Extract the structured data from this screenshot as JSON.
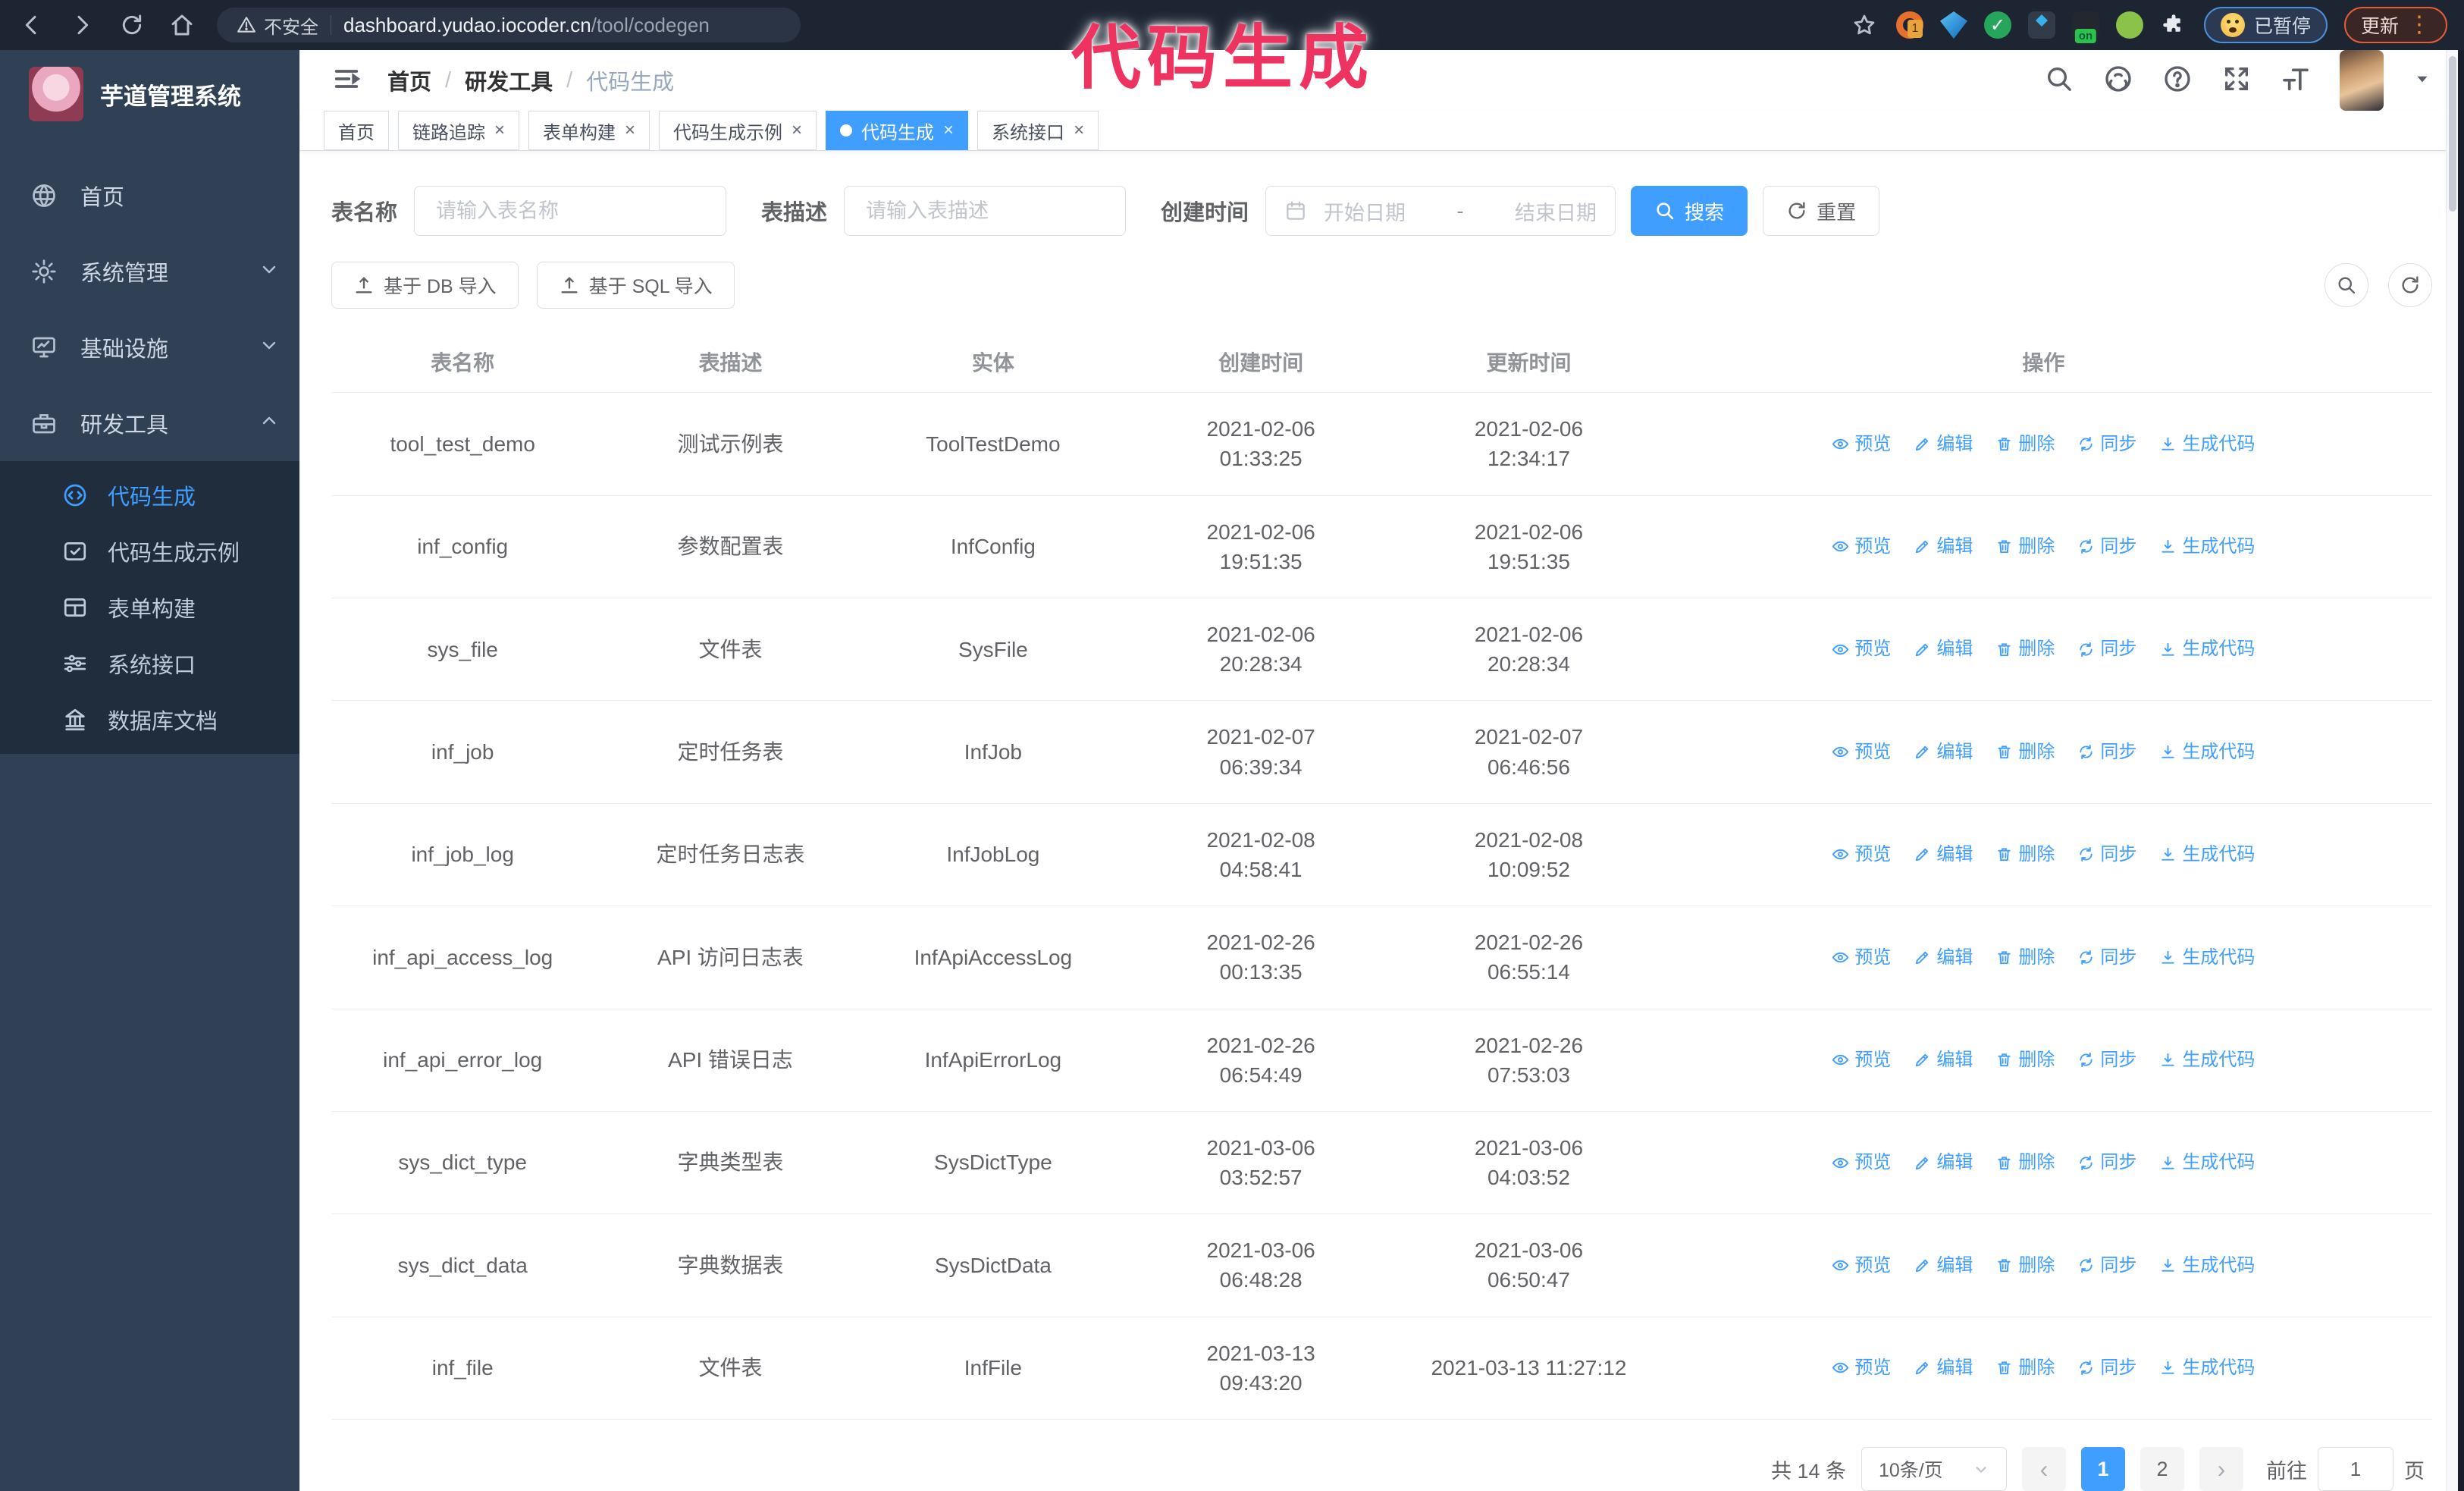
{
  "annotation": {
    "text": "代码生成"
  },
  "colors": {
    "primary": "#409eff",
    "sidebar_bg": "#304156",
    "submenu_bg": "#1f2d3d",
    "annotation": "#ee3360",
    "active_tab": "#409eff"
  },
  "browser": {
    "security_label": "不安全",
    "url_host": "dashboard.yudao.iocoder.cn",
    "url_path": "/tool/codegen",
    "paused_badge": "已暂停",
    "update_button": "更新"
  },
  "sidebar": {
    "title": "芋道管理系统",
    "items": [
      {
        "label": "首页"
      },
      {
        "label": "系统管理"
      },
      {
        "label": "基础设施"
      },
      {
        "label": "研发工具"
      }
    ],
    "subitems": [
      {
        "label": "代码生成"
      },
      {
        "label": "代码生成示例"
      },
      {
        "label": "表单构建"
      },
      {
        "label": "系统接口"
      },
      {
        "label": "数据库文档"
      }
    ]
  },
  "header": {
    "breadcrumb": {
      "home": "首页",
      "group": "研发工具",
      "current": "代码生成"
    }
  },
  "tabs": [
    {
      "label": "首页",
      "closable": false,
      "active": false
    },
    {
      "label": "链路追踪",
      "closable": true,
      "active": false
    },
    {
      "label": "表单构建",
      "closable": true,
      "active": false
    },
    {
      "label": "代码生成示例",
      "closable": true,
      "active": false
    },
    {
      "label": "代码生成",
      "closable": true,
      "active": true
    },
    {
      "label": "系统接口",
      "closable": true,
      "active": false
    }
  ],
  "filters": {
    "name_label": "表名称",
    "name_placeholder": "请输入表名称",
    "desc_label": "表描述",
    "desc_placeholder": "请输入表描述",
    "time_label": "创建时间",
    "start_placeholder": "开始日期",
    "separator": "-",
    "end_placeholder": "结束日期",
    "search_label": "搜索",
    "reset_label": "重置"
  },
  "toolbar": {
    "import_db_label": "基于 DB 导入",
    "import_sql_label": "基于 SQL 导入"
  },
  "table": {
    "columns": {
      "name": "表名称",
      "desc": "表描述",
      "entity": "实体",
      "created": "创建时间",
      "updated": "更新时间",
      "ops": "操作"
    },
    "actions": [
      {
        "label": "预览"
      },
      {
        "label": "编辑"
      },
      {
        "label": "删除"
      },
      {
        "label": "同步"
      },
      {
        "label": "生成代码"
      }
    ],
    "rows": [
      {
        "name": "tool_test_demo",
        "desc": "测试示例表",
        "entity": "ToolTestDemo",
        "created": "2021-02-06 01:33:25",
        "updated": "2021-02-06 12:34:17"
      },
      {
        "name": "inf_config",
        "desc": "参数配置表",
        "entity": "InfConfig",
        "created": "2021-02-06 19:51:35",
        "updated": "2021-02-06 19:51:35"
      },
      {
        "name": "sys_file",
        "desc": "文件表",
        "entity": "SysFile",
        "created": "2021-02-06 20:28:34",
        "updated": "2021-02-06 20:28:34"
      },
      {
        "name": "inf_job",
        "desc": "定时任务表",
        "entity": "InfJob",
        "created": "2021-02-07 06:39:34",
        "updated": "2021-02-07 06:46:56"
      },
      {
        "name": "inf_job_log",
        "desc": "定时任务日志表",
        "entity": "InfJobLog",
        "created": "2021-02-08 04:58:41",
        "updated": "2021-02-08 10:09:52"
      },
      {
        "name": "inf_api_access_log",
        "desc": "API 访问日志表",
        "entity": "InfApiAccessLog",
        "created": "2021-02-26 00:13:35",
        "updated": "2021-02-26 06:55:14"
      },
      {
        "name": "inf_api_error_log",
        "desc": "API 错误日志",
        "entity": "InfApiErrorLog",
        "created": "2021-02-26 06:54:49",
        "updated": "2021-02-26 07:53:03"
      },
      {
        "name": "sys_dict_type",
        "desc": "字典类型表",
        "entity": "SysDictType",
        "created": "2021-03-06 03:52:57",
        "updated": "2021-03-06 04:03:52"
      },
      {
        "name": "sys_dict_data",
        "desc": "字典数据表",
        "entity": "SysDictData",
        "created": "2021-03-06 06:48:28",
        "updated": "2021-03-06 06:50:47"
      },
      {
        "name": "inf_file",
        "desc": "文件表",
        "entity": "InfFile",
        "created": "2021-03-13 09:43:20",
        "updated": "2021-03-13 11:27:12"
      }
    ]
  },
  "pagination": {
    "total": "共 14 条",
    "page_size": "10条/页",
    "prev": "‹",
    "next": "›",
    "page1": "1",
    "page2": "2",
    "goto_prefix": "前往",
    "goto_value": "1",
    "goto_suffix": "页"
  }
}
